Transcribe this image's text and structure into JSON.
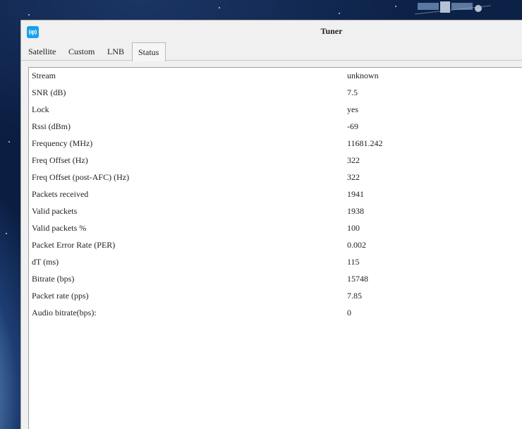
{
  "window": {
    "title": "Tuner",
    "icon": "tuner-app-icon"
  },
  "tabs": [
    {
      "label": "Satellite",
      "active": false
    },
    {
      "label": "Custom",
      "active": false
    },
    {
      "label": "LNB",
      "active": false
    },
    {
      "label": "Status",
      "active": true
    }
  ],
  "status": {
    "rows": [
      {
        "key": "Stream",
        "value": "unknown"
      },
      {
        "key": "SNR (dB)",
        "value": "7.5"
      },
      {
        "key": "Lock",
        "value": "yes"
      },
      {
        "key": "Rssi (dBm)",
        "value": "-69"
      },
      {
        "key": "Frequency (MHz)",
        "value": "11681.242"
      },
      {
        "key": "Freq Offset (Hz)",
        "value": "322"
      },
      {
        "key": "Freq Offset (post-AFC) (Hz)",
        "value": "322"
      },
      {
        "key": "Packets received",
        "value": "1941"
      },
      {
        "key": "Valid packets",
        "value": "1938"
      },
      {
        "key": "Valid packets %",
        "value": "100"
      },
      {
        "key": "Packet Error Rate (PER)",
        "value": "0.002"
      },
      {
        "key": "dT (ms)",
        "value": "115"
      },
      {
        "key": "Bitrate (bps)",
        "value": "15748"
      },
      {
        "key": "Packet rate (pps)",
        "value": "7.85"
      },
      {
        "key": "Audio bitrate(bps):",
        "value": "0"
      }
    ]
  },
  "colors": {
    "accent": "#1aa0e8",
    "window_bg": "#f0f0f0",
    "panel_bg": "#ffffff"
  }
}
